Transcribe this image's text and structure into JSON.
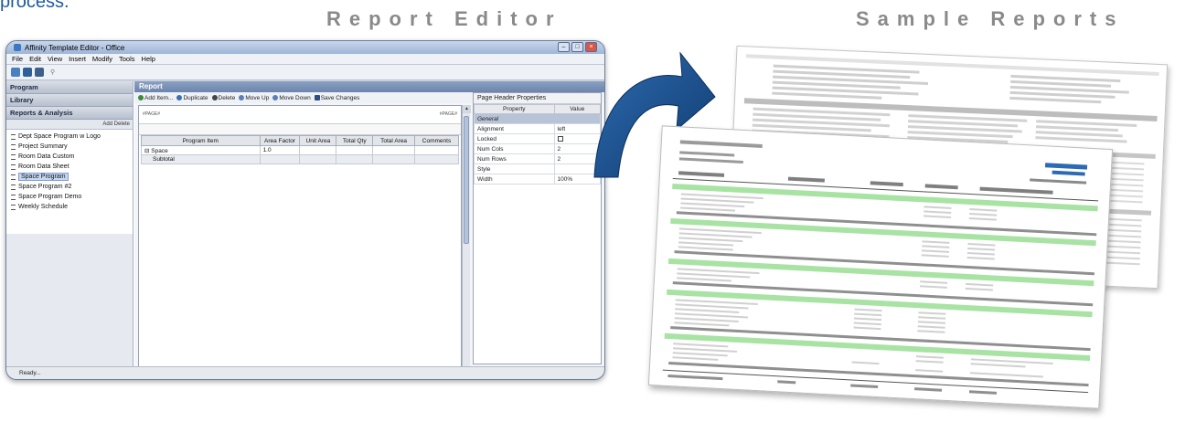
{
  "page": {
    "top_fragment": "process.",
    "heading_left": "Report Editor",
    "heading_right": "Sample Reports"
  },
  "app": {
    "title": "Affinity Template Editor - Office",
    "menu": [
      "File",
      "Edit",
      "View",
      "Insert",
      "Modify",
      "Tools",
      "Help"
    ],
    "window_buttons": [
      "–",
      "□",
      "×"
    ],
    "sidebar": {
      "sections": [
        "Program",
        "Library",
        "Reports & Analysis"
      ],
      "tools": "Add   Delete",
      "items": [
        {
          "label": "Dept Space Program w Logo",
          "selected": false
        },
        {
          "label": "Project Summary",
          "selected": false
        },
        {
          "label": "Room Data Custom",
          "selected": false
        },
        {
          "label": "Room Data Sheet",
          "selected": false
        },
        {
          "label": "Space Program",
          "selected": true
        },
        {
          "label": "Space Program  #2",
          "selected": false
        },
        {
          "label": "Space Program Demo",
          "selected": false
        },
        {
          "label": "Weekly Schedule",
          "selected": false
        }
      ]
    },
    "report": {
      "title": "Report",
      "toolbar": [
        "Add Item...",
        "Duplicate",
        "Delete",
        "Move Up",
        "Move Down",
        "Save Changes"
      ],
      "grid_headers": [
        "Program Item",
        "Area Factor",
        "Unit Area",
        "Total Qty",
        "Total Area",
        "Comments"
      ],
      "rows": [
        [
          "Space",
          "1.0",
          "",
          "",
          "",
          ""
        ],
        [
          "Subtotal",
          "",
          "",
          "",
          "",
          ""
        ]
      ]
    },
    "properties": {
      "title": "Page Header Properties",
      "headers": [
        "Property",
        "Value"
      ],
      "category": "General",
      "items": [
        {
          "name": "Alignment",
          "value": "left"
        },
        {
          "name": "Locked",
          "value": ""
        },
        {
          "name": "Num Cols",
          "value": "2"
        },
        {
          "name": "Num Rows",
          "value": "2"
        },
        {
          "name": "Style",
          "value": ""
        },
        {
          "name": "Width",
          "value": "100%"
        }
      ]
    },
    "status": "Ready..."
  },
  "colors": {
    "heading": "#8a8a8a",
    "arrow": "#1d4f8c",
    "brand_blue": "#2c6ab3",
    "sheet_highlight": "#a8e3a4"
  }
}
